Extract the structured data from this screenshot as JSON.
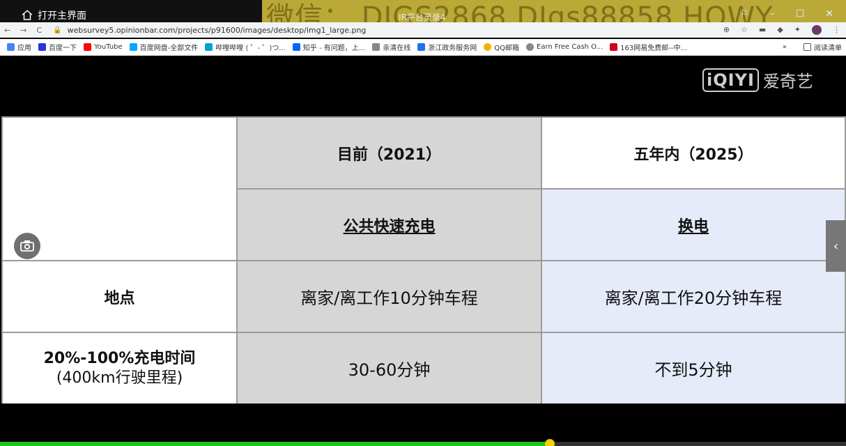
{
  "overlay": {
    "home_label": "打开主界面",
    "watermark": "微信：  DJGS2868   DJgs88858   HQWY",
    "watermark_small": "IR平台灵录4",
    "window_controls": [
      "⚐",
      "–",
      "☐",
      "✕"
    ]
  },
  "browser": {
    "url": "websurvey5.opinionbar.com/projects/p91600/images/desktop/img1_large.png",
    "bookmarks": [
      {
        "label": "应用",
        "color": "#4285f4"
      },
      {
        "label": "百度一下",
        "color": "#2932e1"
      },
      {
        "label": "YouTube",
        "color": "#ff0000"
      },
      {
        "label": "百度网盘-全部文件",
        "color": "#06a7ff"
      },
      {
        "label": "哔哩哔哩 ( ゜- ゜)つ...",
        "color": "#00a1d6"
      },
      {
        "label": "知乎 - 有问题，上...",
        "color": "#0066ff"
      },
      {
        "label": "亲清在线",
        "color": "#888888"
      },
      {
        "label": "浙江政务服务网",
        "color": "#1a73e8"
      },
      {
        "label": "QQ邮箱",
        "color": "#f0b400"
      },
      {
        "label": "Earn Free Cash O...",
        "color": "#888888"
      },
      {
        "label": "163网易免费邮--中...",
        "color": "#d0021b"
      }
    ],
    "bookmarks_more": "»",
    "reading_list": "阅读清单"
  },
  "logo": {
    "mark": "iQIYI",
    "name": "爱奇艺"
  },
  "table": {
    "header_current": "目前（2021）",
    "header_future": "五年内（2025）",
    "tech_current": "公共快速充电",
    "tech_future": "换电",
    "row1_label": "地点",
    "row1_current": "离家/离工作10分钟车程",
    "row1_future": "离家/离工作20分钟车程",
    "row2_label_line1": "20%-100%充电时间",
    "row2_label_line2": "(400km行驶里程)",
    "row2_current": "30-60分钟",
    "row2_future": "不到5分钟"
  },
  "player": {
    "progress_fraction": 0.65
  }
}
